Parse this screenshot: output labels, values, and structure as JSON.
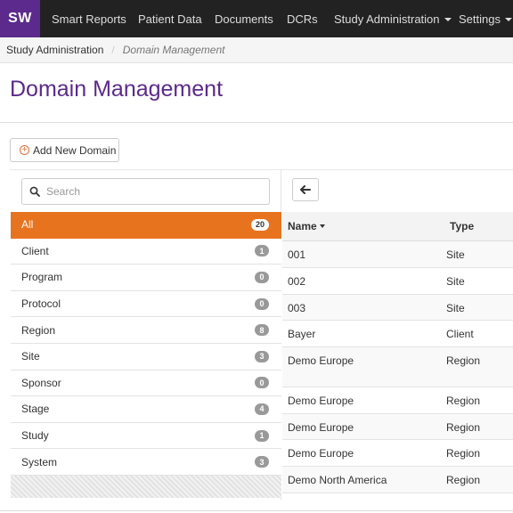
{
  "nav": {
    "brand": "SW",
    "items": [
      {
        "label": "Smart Reports",
        "dropdown": false
      },
      {
        "label": "Patient Data",
        "dropdown": false
      },
      {
        "label": "Documents",
        "dropdown": false
      },
      {
        "label": "DCRs",
        "dropdown": false
      },
      {
        "label": "Study Administration",
        "dropdown": true
      },
      {
        "label": "Settings",
        "dropdown": true
      }
    ]
  },
  "breadcrumb": {
    "parent": "Study Administration",
    "separator": "/",
    "current": "Domain Management"
  },
  "page": {
    "title": "Domain Management",
    "add_button": "Add New Domain"
  },
  "search": {
    "placeholder": "Search"
  },
  "categories": [
    {
      "label": "All",
      "count": "20",
      "active": true
    },
    {
      "label": "Client",
      "count": "1"
    },
    {
      "label": "Program",
      "count": "0"
    },
    {
      "label": "Protocol",
      "count": "0"
    },
    {
      "label": "Region",
      "count": "8"
    },
    {
      "label": "Site",
      "count": "3"
    },
    {
      "label": "Sponsor",
      "count": "0"
    },
    {
      "label": "Stage",
      "count": "4"
    },
    {
      "label": "Study",
      "count": "1"
    },
    {
      "label": "System",
      "count": "3"
    }
  ],
  "table": {
    "columns": {
      "name": "Name",
      "type": "Type"
    },
    "rows": [
      {
        "name": "001",
        "type": "Site"
      },
      {
        "name": "002",
        "type": "Site"
      },
      {
        "name": "003",
        "type": "Site"
      },
      {
        "name": "Bayer",
        "type": "Client"
      },
      {
        "name": "Demo Europe",
        "type": "Region"
      },
      {
        "name": "Demo Europe",
        "type": "Region"
      },
      {
        "name": "Demo Europe",
        "type": "Region"
      },
      {
        "name": "Demo Europe",
        "type": "Region"
      },
      {
        "name": "Demo North America",
        "type": "Region"
      }
    ]
  },
  "colors": {
    "brand": "#5b2a8c",
    "active": "#e8731f",
    "nav_bg": "#222222"
  }
}
